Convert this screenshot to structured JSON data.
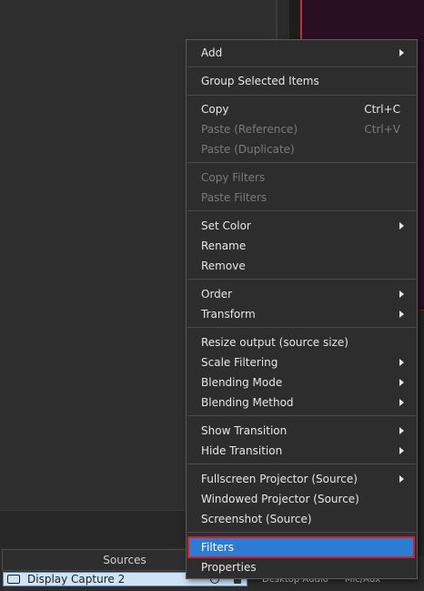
{
  "context_menu": {
    "items": [
      {
        "label": "Add",
        "submenu": true
      },
      {
        "label": "Group Selected Items"
      },
      {
        "label": "Copy",
        "shortcut": "Ctrl+C"
      },
      {
        "label": "Paste (Reference)",
        "shortcut": "Ctrl+V",
        "disabled": true
      },
      {
        "label": "Paste (Duplicate)",
        "disabled": true
      },
      {
        "label": "Copy Filters",
        "disabled": true
      },
      {
        "label": "Paste Filters",
        "disabled": true
      },
      {
        "label": "Set Color",
        "submenu": true
      },
      {
        "label": "Rename"
      },
      {
        "label": "Remove"
      },
      {
        "label": "Order",
        "submenu": true
      },
      {
        "label": "Transform",
        "submenu": true
      },
      {
        "label": "Resize output (source size)"
      },
      {
        "label": "Scale Filtering",
        "submenu": true
      },
      {
        "label": "Blending Mode",
        "submenu": true
      },
      {
        "label": "Blending Method",
        "submenu": true
      },
      {
        "label": "Show Transition",
        "submenu": true
      },
      {
        "label": "Hide Transition",
        "submenu": true
      },
      {
        "label": "Fullscreen Projector (Source)",
        "submenu": true
      },
      {
        "label": "Windowed Projector (Source)"
      },
      {
        "label": "Screenshot (Source)"
      },
      {
        "label": "Filters",
        "highlighted": true
      },
      {
        "label": "Properties"
      }
    ]
  },
  "sources_panel": {
    "title": "Sources",
    "selected_source": "Display Capture 2"
  },
  "audio_mixer": {
    "labels": [
      "Desktop Audio",
      "Mic/Aux"
    ]
  },
  "colors": {
    "menu_background": "#2d2d2d",
    "highlight": "#2e7bd3",
    "highlight_outline": "#d1202a",
    "disabled_text": "#7a7a7a",
    "preview_border": "#c2313a"
  }
}
